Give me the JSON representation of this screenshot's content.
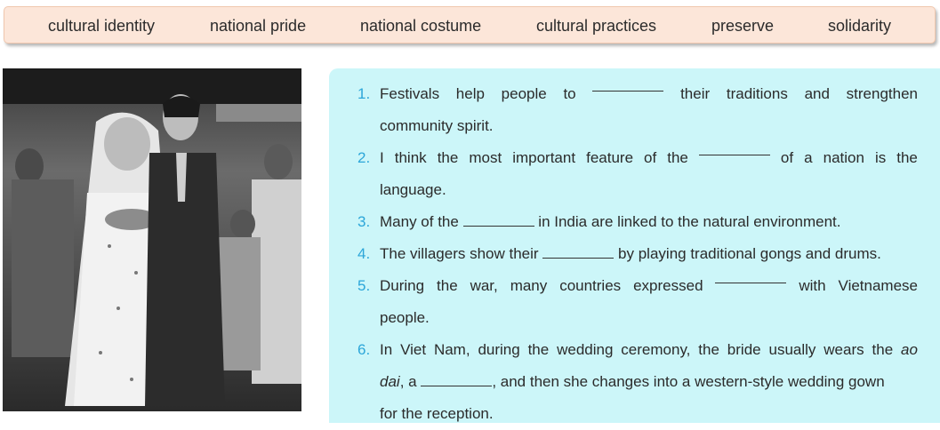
{
  "word_bank": [
    "cultural identity",
    "national pride",
    "national costume",
    "cultural practices",
    "preserve",
    "solidarity"
  ],
  "sentences": [
    {
      "num": "1.",
      "line1": [
        "Festivals",
        "help",
        "people",
        "to",
        "BLANK",
        "their",
        "traditions",
        "and",
        "strengthen"
      ],
      "line2": "community spirit."
    },
    {
      "num": "2.",
      "line1": [
        "I",
        "think",
        "the",
        "most",
        "important",
        "feature",
        "of",
        "the",
        "BLANK",
        "of",
        "a",
        "nation",
        "is",
        "the"
      ],
      "line2": "language."
    },
    {
      "num": "3.",
      "before": "Many of the",
      "after": "in India are linked to the natural environment."
    },
    {
      "num": "4.",
      "before": "The villagers show their",
      "after": "by playing traditional gongs and drums."
    },
    {
      "num": "5.",
      "line1": [
        "During",
        "the",
        "war,",
        "many",
        "countries",
        "expressed",
        "BLANK",
        "with",
        "Vietnamese"
      ],
      "line2": "people."
    },
    {
      "num": "6.",
      "line1": [
        "In",
        "Viet",
        "Nam,",
        "during",
        "the",
        "wedding",
        "ceremony,",
        "the",
        "bride",
        "usually",
        "wears",
        "the"
      ],
      "italic1": "ao",
      "italic2": "dai",
      "line2_rest": ", a",
      "line2_after": ", and then she changes into a western-style wedding gown",
      "line3": "for the reception."
    }
  ]
}
